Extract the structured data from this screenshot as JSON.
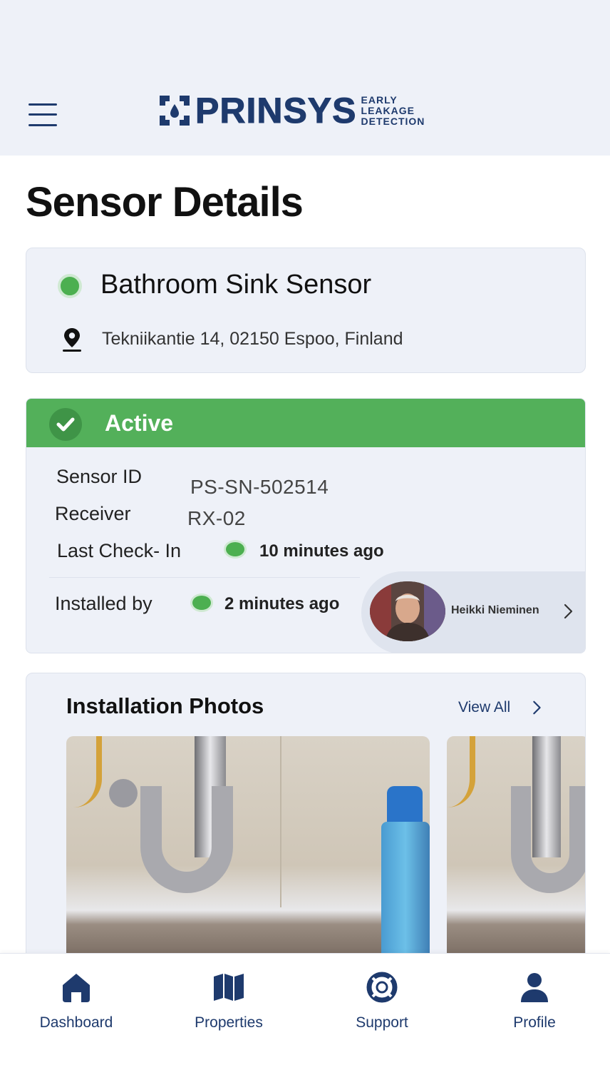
{
  "header": {
    "logo_word": "PRINSYS",
    "logo_tagline": [
      "EARLY",
      "LEAKAGE",
      "DETECTION"
    ],
    "menu_icon": "hamburger-icon"
  },
  "page": {
    "title": "Sensor Details"
  },
  "sensor": {
    "name": "Bathroom Sink Sensor",
    "address": "Tekniikantie 14, 02150 Espoo, Finland",
    "status_color": "#4caf50"
  },
  "status": {
    "label": "Active",
    "bar_color": "#53b05a",
    "rows": {
      "sensor_id_label": "Sensor ID",
      "sensor_id_value": "PS-SN-502514",
      "receiver_label": "Receiver",
      "receiver_value": "RX-02",
      "last_checkin_label": "Last Check- In",
      "last_checkin_value": "10 minutes ago",
      "installed_by_label": "Installed by",
      "installed_by_value": "2 minutes ago"
    },
    "installer": {
      "name": "Heikki Nieminen"
    }
  },
  "photos": {
    "title": "Installation Photos",
    "view_all": "View All"
  },
  "nav": {
    "items": [
      {
        "label": "Dashboard",
        "icon": "home-icon"
      },
      {
        "label": "Properties",
        "icon": "map-icon"
      },
      {
        "label": "Support",
        "icon": "lifebuoy-icon"
      },
      {
        "label": "Profile",
        "icon": "person-icon"
      }
    ]
  },
  "colors": {
    "brand": "#1e3a6d",
    "accent_green": "#53b05a",
    "card_bg": "#eef1f8"
  }
}
